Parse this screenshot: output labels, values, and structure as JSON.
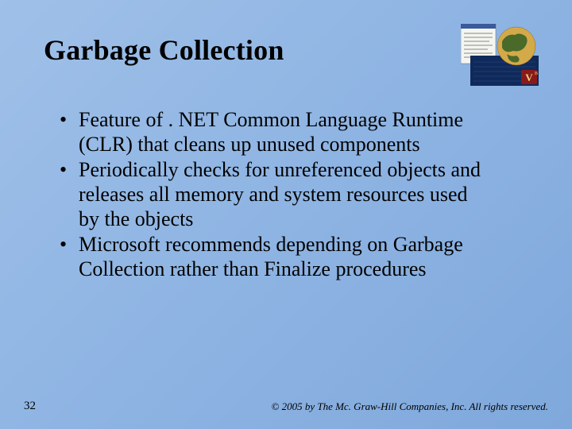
{
  "slide": {
    "title": "Garbage Collection",
    "bullets": [
      "Feature of . NET Common Language Runtime (CLR) that cleans up unused components",
      "Periodically checks for unreferenced objects and releases all memory and system resources used by the objects",
      "Microsoft recommends depending on Garbage Collection rather than Finalize procedures"
    ],
    "page_number": "32",
    "copyright": "© 2005 by The Mc. Graw-Hill Companies, Inc. All rights reserved."
  }
}
